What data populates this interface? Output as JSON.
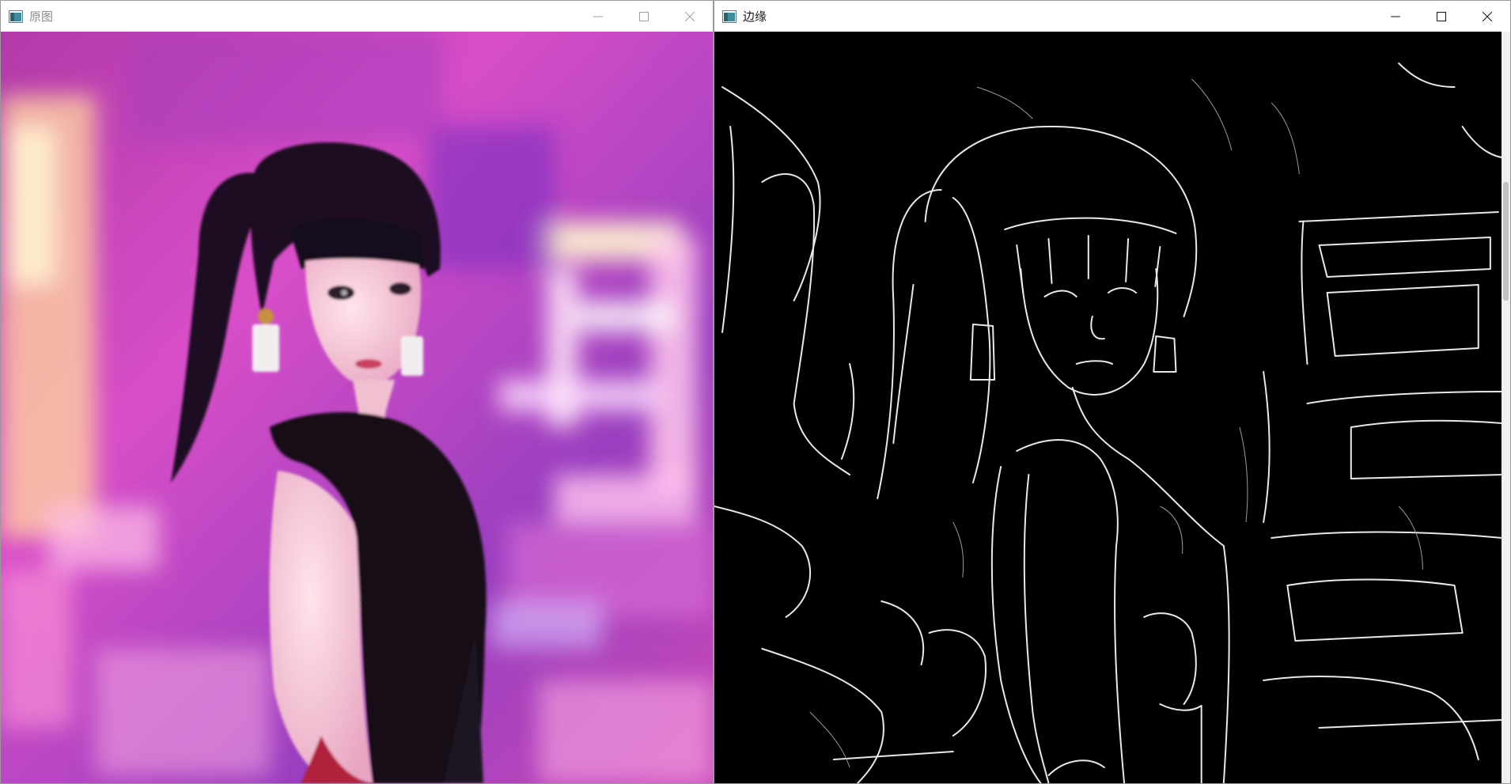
{
  "windows": [
    {
      "title": "原图",
      "controls": {
        "minimize_icon": "minimize-icon",
        "maximize_icon": "maximize-icon",
        "close_icon": "close-icon"
      }
    },
    {
      "title": "边缘",
      "controls": {
        "minimize_icon": "minimize-icon",
        "maximize_icon": "maximize-icon",
        "close_icon": "close-icon"
      }
    }
  ],
  "colors": {
    "titlebar_bg": "#ffffff",
    "inactive_title": "#8c8c8c",
    "active_title": "#1a1a1a",
    "edge_canvas_bg": "#000000",
    "edge_line": "#ffffff",
    "neon_magenta": "#e040c8",
    "neon_purple": "#8a3db8"
  }
}
